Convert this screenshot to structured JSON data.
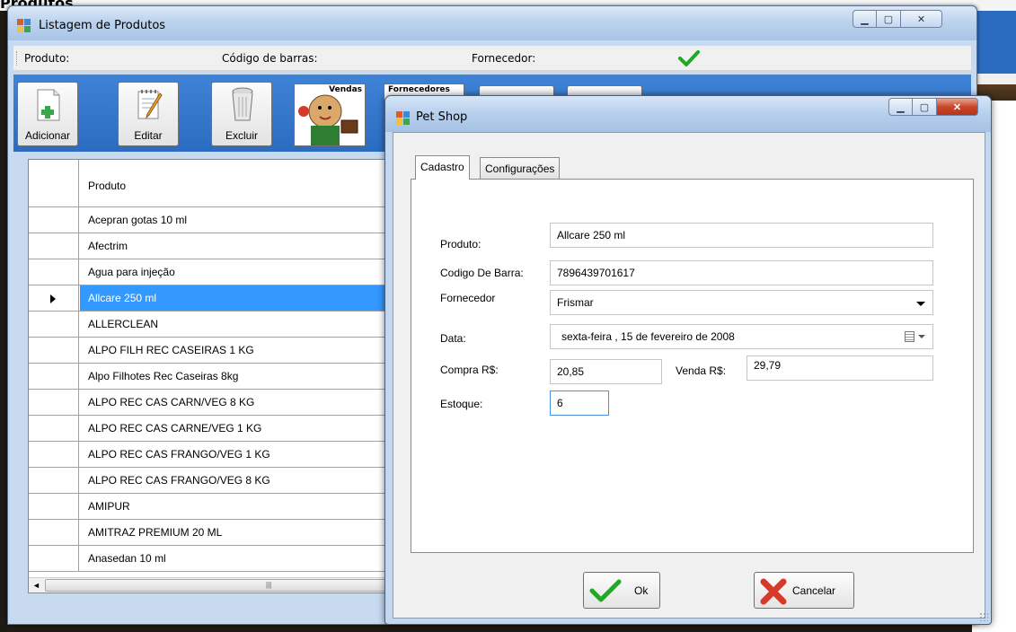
{
  "desktop": {
    "title": "Produtos"
  },
  "main_window": {
    "title": "Listagem de Produtos",
    "filter_bar": {
      "produto_label": "Produto:",
      "codigo_label": "Código de barras:",
      "fornecedor_label": "Fornecedor:"
    },
    "toolbar": {
      "adicionar": "Adicionar",
      "editar": "Editar",
      "excluir": "Excluir",
      "vendas": "Vendas",
      "fornecedores": "Fornecedores"
    },
    "grid": {
      "column": "Produto",
      "rows": [
        "Acepran gotas 10 ml",
        "Afectrim",
        "Agua para injeção",
        "Allcare 250 ml",
        "ALLERCLEAN",
        "ALPO FILH REC CASEIRAS 1 KG",
        "Alpo Filhotes Rec Caseiras 8kg",
        "ALPO REC CAS CARN/VEG 8 KG",
        "ALPO REC CAS CARNE/VEG 1 KG",
        "ALPO REC CAS FRANGO/VEG 1 KG",
        "ALPO REC CAS FRANGO/VEG 8 KG",
        "AMIPUR",
        "AMITRAZ PREMIUM 20 ML",
        "Anasedan 10 ml"
      ],
      "selected_index": 3
    }
  },
  "dialog": {
    "title": "Pet Shop",
    "tabs": [
      "Cadastro",
      "Configurações"
    ],
    "active_tab": "Cadastro",
    "form": {
      "produto_label": "Produto:",
      "produto_value": "Allcare 250 ml",
      "codigo_label": "Codigo De Barra:",
      "codigo_value": "7896439701617",
      "fornecedor_label": "Fornecedor",
      "fornecedor_value": "Frismar",
      "data_label": "Data:",
      "data_value": "sexta-feira  , 15 de  fevereiro  de 2008",
      "compra_label": "Compra R$:",
      "compra_value": "20,85",
      "venda_label": "Venda R$:",
      "venda_value": "29,79",
      "estoque_label": "Estoque:",
      "estoque_value": "6"
    },
    "buttons": {
      "ok": "Ok",
      "cancel": "Cancelar"
    }
  },
  "colors": {
    "selection": "#3399ff",
    "toolbar_bg": "#2b6cc0",
    "check_green": "#22a822",
    "cancel_red": "#d63a2a"
  }
}
